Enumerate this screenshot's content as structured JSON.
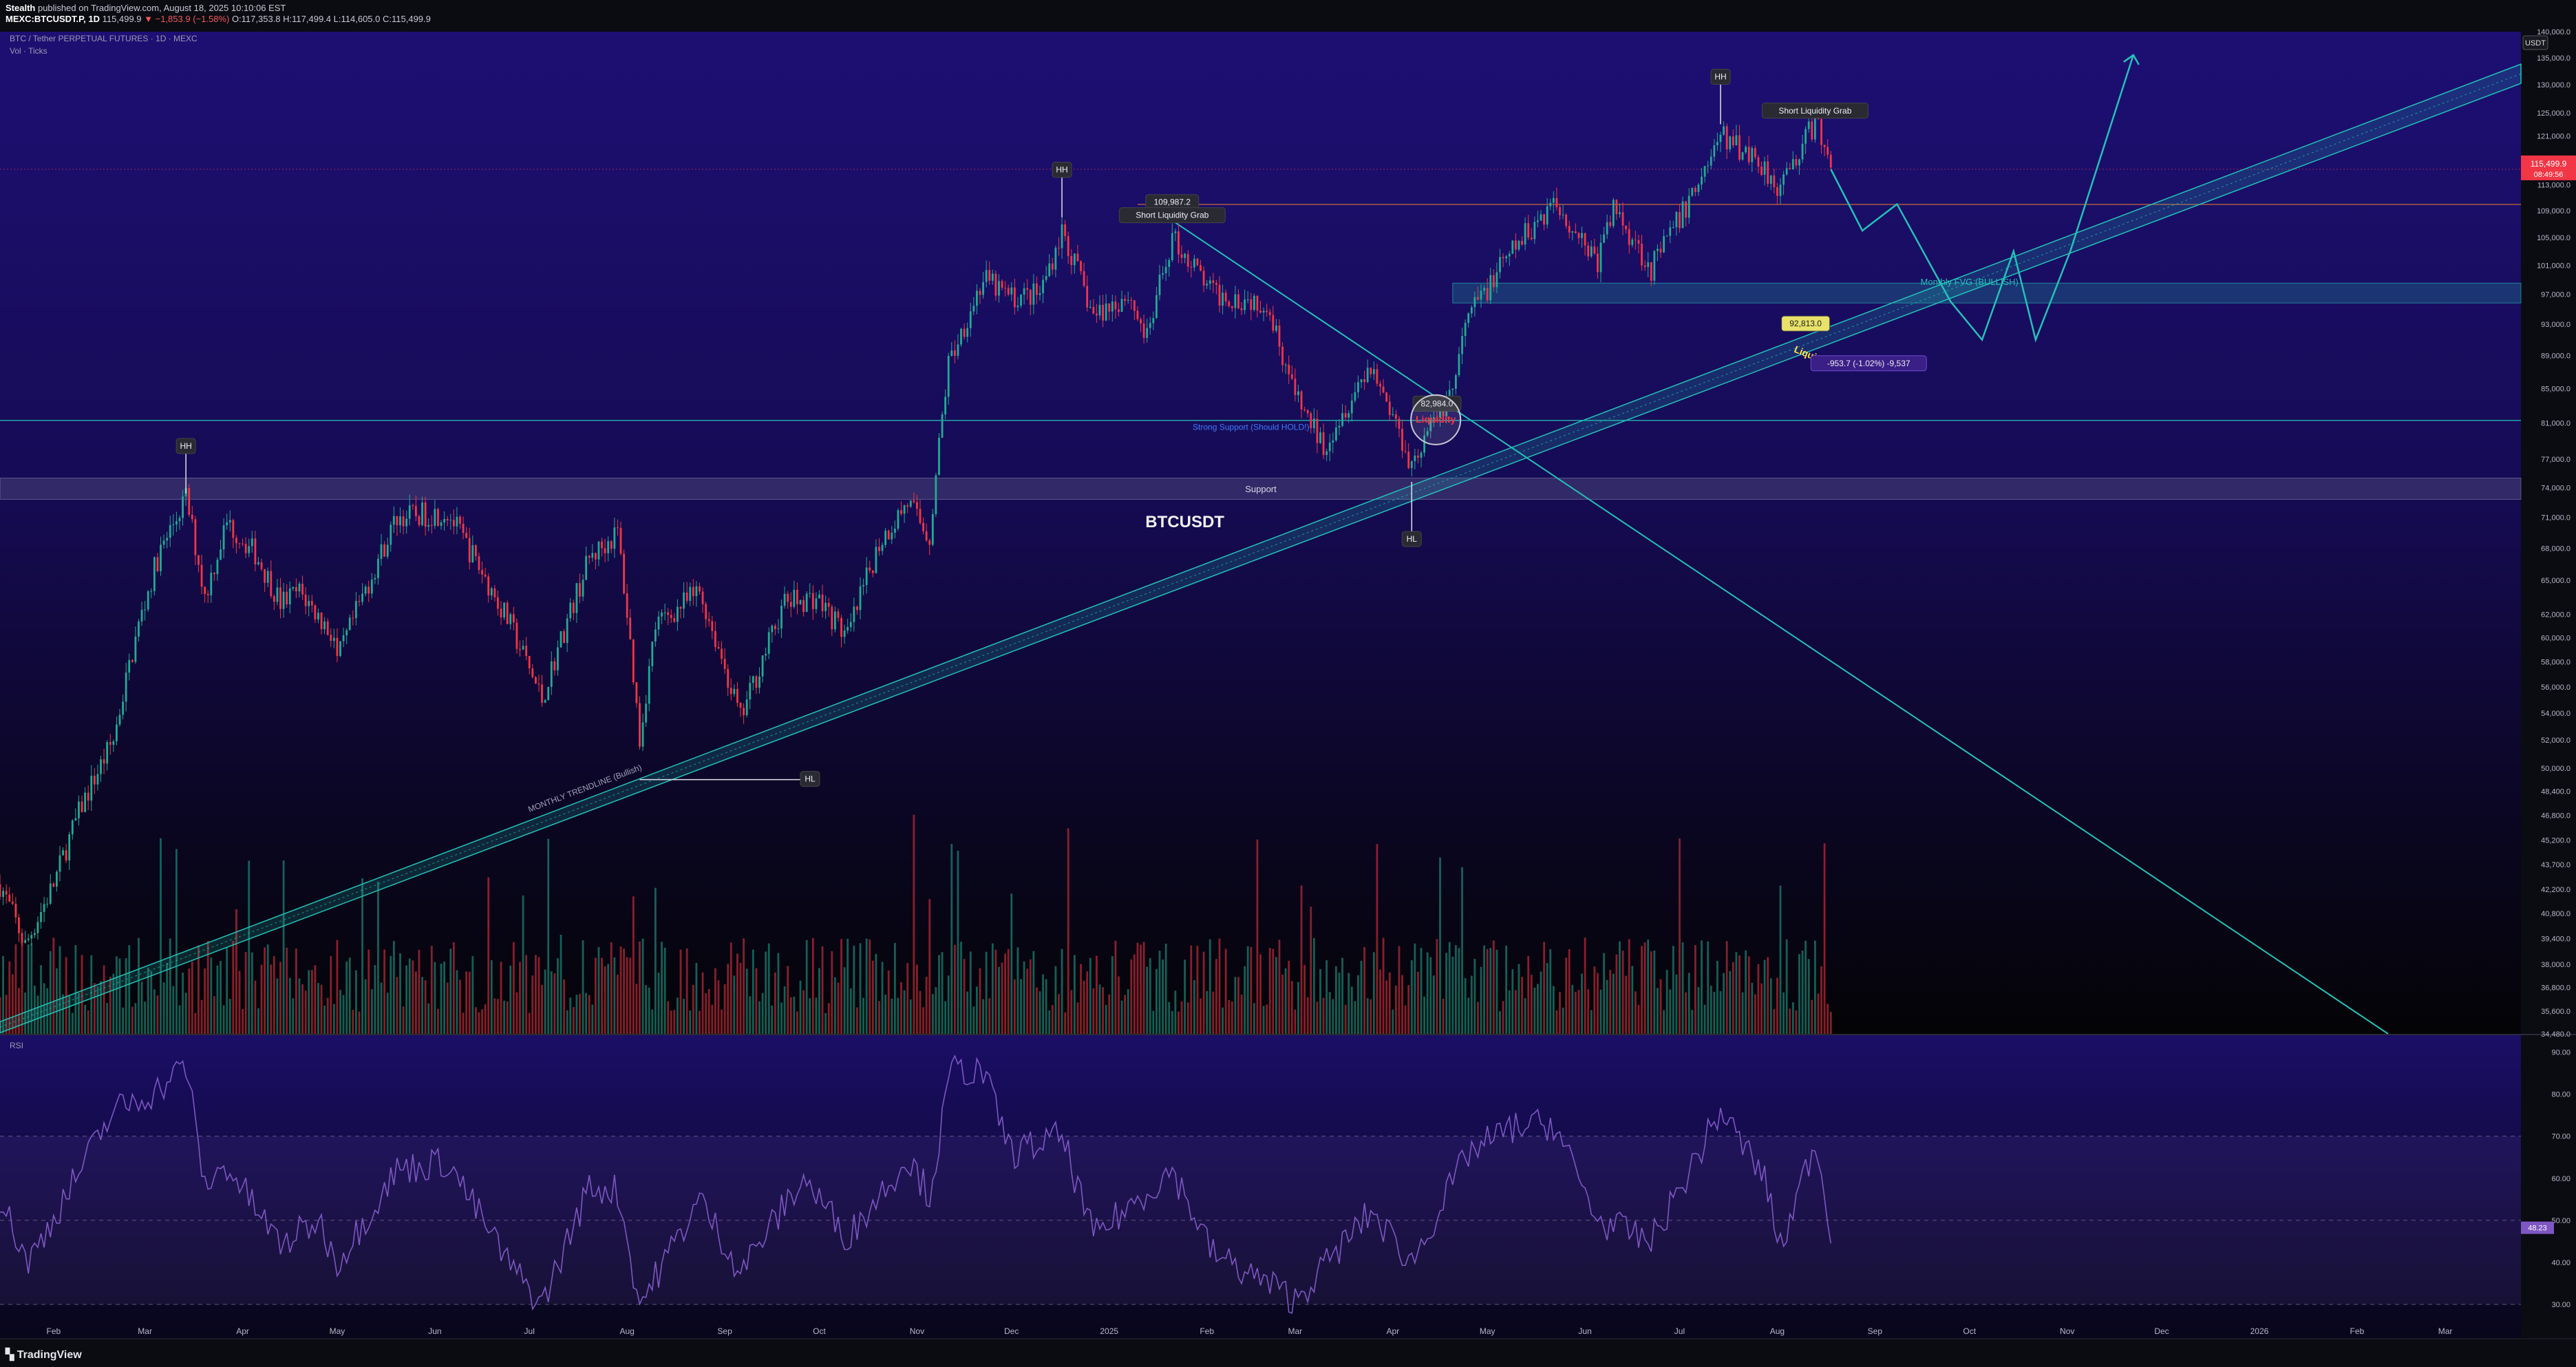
{
  "header": {
    "author": "Stealth",
    "published": "published on TradingView.com, August 18, 2025 10:10:06 EST",
    "symbol_line": "MEXC:BTCUSDT.P, 1D",
    "price": "115,499.9",
    "change": "▼ −1,853.9 (−1.58%)",
    "o": "O:117,353.8",
    "h": "H:117,499.4",
    "l": "L:114,605.0",
    "c": "C:115,499.9"
  },
  "chart_title": "BTC / Tether PERPETUAL FUTURES · 1D · MEXC",
  "indicator_label": "Vol · Ticks",
  "rsi_label": "RSI",
  "currency_badge": "USDT",
  "branding": "TradingView",
  "colors": {
    "bg_top": "#1c0f6e",
    "bg_mid": "#140a44",
    "bg_bottom": "#050508",
    "up": "#22ab94",
    "down": "#f23645",
    "trend": "#24c2b8",
    "rsi_line": "#7e57c2",
    "label_bg": "#2a2a33",
    "current_price": "#f23645"
  },
  "chart_data": {
    "type": "line",
    "title": "BTC / Tether PERPETUAL FUTURES · 1D · MEXC",
    "y_scale": "log",
    "ylim": [
      34480,
      140000
    ],
    "yticks": [
      "140,000.0",
      "135,000.0",
      "130,000.0",
      "125,000.0",
      "121,000.0",
      "117,000.0",
      "113,000.0",
      "109,000.0",
      "105,000.0",
      "101,000.0",
      "97,000.0",
      "93,000.0",
      "89,000.0",
      "85,000.0",
      "81,000.0",
      "77,000.0",
      "74,000.0",
      "71,000.0",
      "68,000.0",
      "65,000.0",
      "62,000.0",
      "60,000.0",
      "58,000.0",
      "56,000.0",
      "54,000.0",
      "52,000.0",
      "50,000.0",
      "48,400.0",
      "46,800.0",
      "45,200.0",
      "43,700.0",
      "42,200.0",
      "40,800.0",
      "39,400.0",
      "38,000.0",
      "36,800.0",
      "35,600.0",
      "34,480.0"
    ],
    "ytick_values": [
      140000,
      135000,
      130000,
      125000,
      121000,
      117000,
      113000,
      109000,
      105000,
      101000,
      97000,
      93000,
      89000,
      85000,
      81000,
      77000,
      74000,
      71000,
      68000,
      65000,
      62000,
      60000,
      58000,
      56000,
      54000,
      52000,
      50000,
      48400,
      46800,
      45200,
      43700,
      42200,
      40800,
      39400,
      38000,
      36800,
      35600,
      34480
    ],
    "xlim": [
      "2024-01-15",
      "2026-03-25"
    ],
    "xticks": [
      {
        "label": "Feb",
        "date": "2024-02-01"
      },
      {
        "label": "Mar",
        "date": "2024-03-01"
      },
      {
        "label": "Apr",
        "date": "2024-04-01"
      },
      {
        "label": "May",
        "date": "2024-05-01"
      },
      {
        "label": "Jun",
        "date": "2024-06-01"
      },
      {
        "label": "Jul",
        "date": "2024-07-01"
      },
      {
        "label": "Aug",
        "date": "2024-08-01"
      },
      {
        "label": "Sep",
        "date": "2024-09-01"
      },
      {
        "label": "Oct",
        "date": "2024-10-01"
      },
      {
        "label": "Nov",
        "date": "2024-11-01"
      },
      {
        "label": "Dec",
        "date": "2024-12-01"
      },
      {
        "label": "2025",
        "date": "2025-01-01"
      },
      {
        "label": "Feb",
        "date": "2025-02-01"
      },
      {
        "label": "Mar",
        "date": "2025-03-01"
      },
      {
        "label": "Apr",
        "date": "2025-04-01"
      },
      {
        "label": "May",
        "date": "2025-05-01"
      },
      {
        "label": "Jun",
        "date": "2025-06-01"
      },
      {
        "label": "Jul",
        "date": "2025-07-01"
      },
      {
        "label": "Aug",
        "date": "2025-08-01"
      },
      {
        "label": "Sep",
        "date": "2025-09-01"
      },
      {
        "label": "Oct",
        "date": "2025-10-01"
      },
      {
        "label": "Nov",
        "date": "2025-11-01"
      },
      {
        "label": "Dec",
        "date": "2025-12-01"
      },
      {
        "label": "2026",
        "date": "2026-01-01"
      },
      {
        "label": "Feb",
        "date": "2026-02-01"
      },
      {
        "label": "Mar",
        "date": "2026-03-01"
      }
    ],
    "price_series": [
      [
        "2024-01-15",
        42500
      ],
      [
        "2024-01-23",
        39000
      ],
      [
        "2024-02-01",
        42500
      ],
      [
        "2024-02-10",
        47500
      ],
      [
        "2024-02-20",
        52000
      ],
      [
        "2024-02-28",
        61000
      ],
      [
        "2024-03-05",
        67000
      ],
      [
        "2024-03-14",
        73000
      ],
      [
        "2024-03-20",
        63500
      ],
      [
        "2024-03-27",
        70500
      ],
      [
        "2024-04-05",
        67500
      ],
      [
        "2024-04-13",
        63000
      ],
      [
        "2024-04-19",
        64000
      ],
      [
        "2024-04-30",
        60000
      ],
      [
        "2024-05-01",
        58000
      ],
      [
        "2024-05-20",
        71000
      ],
      [
        "2024-06-05",
        71500
      ],
      [
        "2024-06-25",
        61000
      ],
      [
        "2024-07-05",
        55000
      ],
      [
        "2024-07-20",
        67000
      ],
      [
        "2024-07-29",
        69500
      ],
      [
        "2024-08-05",
        52000
      ],
      [
        "2024-08-10",
        61000
      ],
      [
        "2024-08-24",
        64000
      ],
      [
        "2024-09-06",
        53500
      ],
      [
        "2024-09-20",
        63000
      ],
      [
        "2024-09-30",
        63500
      ],
      [
        "2024-10-10",
        60000
      ],
      [
        "2024-10-20",
        68500
      ],
      [
        "2024-10-29",
        72500
      ],
      [
        "2024-11-05",
        69000
      ],
      [
        "2024-11-11",
        88000
      ],
      [
        "2024-11-22",
        99000
      ],
      [
        "2024-12-01",
        96500
      ],
      [
        "2024-12-10",
        97000
      ],
      [
        "2024-12-17",
        106000
      ],
      [
        "2024-12-27",
        94000
      ],
      [
        "2025-01-07",
        97000
      ],
      [
        "2025-01-13",
        91000
      ],
      [
        "2025-01-21",
        105000
      ],
      [
        "2025-02-03",
        97000
      ],
      [
        "2025-02-20",
        96000
      ],
      [
        "2025-03-01",
        84000
      ],
      [
        "2025-03-10",
        78500
      ],
      [
        "2025-03-25",
        88000
      ],
      [
        "2025-04-07",
        76500
      ],
      [
        "2025-04-20",
        85000
      ],
      [
        "2025-04-25",
        94000
      ],
      [
        "2025-05-09",
        103000
      ],
      [
        "2025-05-22",
        110500
      ],
      [
        "2025-06-05",
        101500
      ],
      [
        "2025-06-10",
        109500
      ],
      [
        "2025-06-22",
        100500
      ],
      [
        "2025-07-03",
        109500
      ],
      [
        "2025-07-14",
        121000
      ],
      [
        "2025-07-25",
        117500
      ],
      [
        "2025-08-02",
        112500
      ],
      [
        "2025-08-13",
        123500
      ],
      [
        "2025-08-18",
        115500
      ]
    ],
    "rsi_series": [
      [
        "2024-01-15",
        55
      ],
      [
        "2024-01-24",
        40
      ],
      [
        "2024-02-05",
        56
      ],
      [
        "2024-02-20",
        76
      ],
      [
        "2024-03-05",
        81
      ],
      [
        "2024-03-14",
        87
      ],
      [
        "2024-03-20",
        58
      ],
      [
        "2024-03-27",
        63
      ],
      [
        "2024-04-13",
        44
      ],
      [
        "2024-04-25",
        50
      ],
      [
        "2024-05-01",
        40
      ],
      [
        "2024-05-20",
        62
      ],
      [
        "2024-06-05",
        64
      ],
      [
        "2024-06-25",
        39
      ],
      [
        "2024-07-05",
        30
      ],
      [
        "2024-07-20",
        58
      ],
      [
        "2024-07-29",
        57
      ],
      [
        "2024-08-05",
        30
      ],
      [
        "2024-08-24",
        55
      ],
      [
        "2024-09-06",
        38
      ],
      [
        "2024-09-26",
        60
      ],
      [
        "2024-10-10",
        46
      ],
      [
        "2024-10-29",
        65
      ],
      [
        "2024-11-05",
        56
      ],
      [
        "2024-11-12",
        86
      ],
      [
        "2024-11-22",
        85
      ],
      [
        "2024-12-01",
        66
      ],
      [
        "2024-12-17",
        70
      ],
      [
        "2024-12-27",
        46
      ],
      [
        "2025-01-21",
        62
      ],
      [
        "2025-02-03",
        42
      ],
      [
        "2025-02-25",
        33
      ],
      [
        "2025-03-01",
        31
      ],
      [
        "2025-03-25",
        52
      ],
      [
        "2025-04-07",
        40
      ],
      [
        "2025-04-25",
        66
      ],
      [
        "2025-05-09",
        72
      ],
      [
        "2025-05-22",
        73
      ],
      [
        "2025-06-05",
        50
      ],
      [
        "2025-06-22",
        45
      ],
      [
        "2025-07-03",
        60
      ],
      [
        "2025-07-14",
        76
      ],
      [
        "2025-07-28",
        60
      ],
      [
        "2025-08-02",
        43
      ],
      [
        "2025-08-13",
        69
      ],
      [
        "2025-08-18",
        48
      ]
    ],
    "rsi_levels": [
      70,
      50,
      30
    ],
    "rsi_yticks": [
      "90.00",
      "80.00",
      "70.00",
      "60.00",
      "50.00",
      "40.00",
      "30.00"
    ],
    "rsi_ytick_values": [
      90,
      80,
      70,
      60,
      50,
      40,
      30
    ],
    "rsi_value_label": "48.23",
    "current_price_label": "115,499.9",
    "countdown_label": "08:49:56",
    "horizontal_levels": [
      {
        "label": "Support",
        "from": 72800,
        "to": 75000
      },
      {
        "label": "Strong Support (Should HOLD!)",
        "value": 81300
      },
      {
        "label": "Monthly FVG (BULLISH)",
        "from": 95800,
        "to": 98500
      },
      {
        "label": "",
        "value": 109950
      }
    ],
    "annotations": [
      {
        "text": "HH",
        "date": "2024-03-14",
        "price": 73400
      },
      {
        "text": "HH",
        "date": "2024-12-17",
        "price": 108000
      },
      {
        "text": "HH",
        "date": "2025-07-14",
        "price": 123000
      },
      {
        "text": "HL",
        "date": "2024-08-05",
        "price": 49200
      },
      {
        "text": "HL",
        "date": "2025-04-07",
        "price": 74600
      },
      {
        "text": "109,987.2",
        "date": "2025-01-21",
        "price": 109987
      },
      {
        "text": "Short Liquidity Grab",
        "date": "2025-01-21",
        "price": 108000
      },
      {
        "text": "Short Liquidity Grab",
        "date": "2025-08-13",
        "price": 125000
      },
      {
        "text": "82,984.0",
        "date": "2025-04-15",
        "price": 82984
      },
      {
        "text": "Liquidity",
        "date": "2025-04-12",
        "price": 82000
      },
      {
        "text": "92,813.0",
        "date": "2025-08-10",
        "price": 92813
      },
      {
        "text": "Liquidity",
        "date": "2025-08-13",
        "price": 89500
      },
      {
        "text": "-953.7 (-1.02%) -9,537",
        "date": "2025-08-30",
        "price": 87800
      },
      {
        "text": "MONTHLY TRENDLINE (Bullish)",
        "date": "2024-07-01",
        "price": 47000
      },
      {
        "text": "BTCUSDT",
        "date": "2025-01-25",
        "price": 70000
      }
    ],
    "projection": [
      [
        "2025-08-18",
        115500
      ],
      [
        "2025-08-28",
        106000
      ],
      [
        "2025-09-08",
        110000
      ],
      [
        "2025-09-25",
        96000
      ],
      [
        "2025-10-05",
        91000
      ],
      [
        "2025-10-15",
        103000
      ],
      [
        "2025-10-22",
        91000
      ],
      [
        "2025-11-02",
        103000
      ],
      [
        "2025-11-22",
        135500
      ]
    ],
    "volume_note": "volume histogram, relative values",
    "grid": false,
    "legend": "none"
  }
}
